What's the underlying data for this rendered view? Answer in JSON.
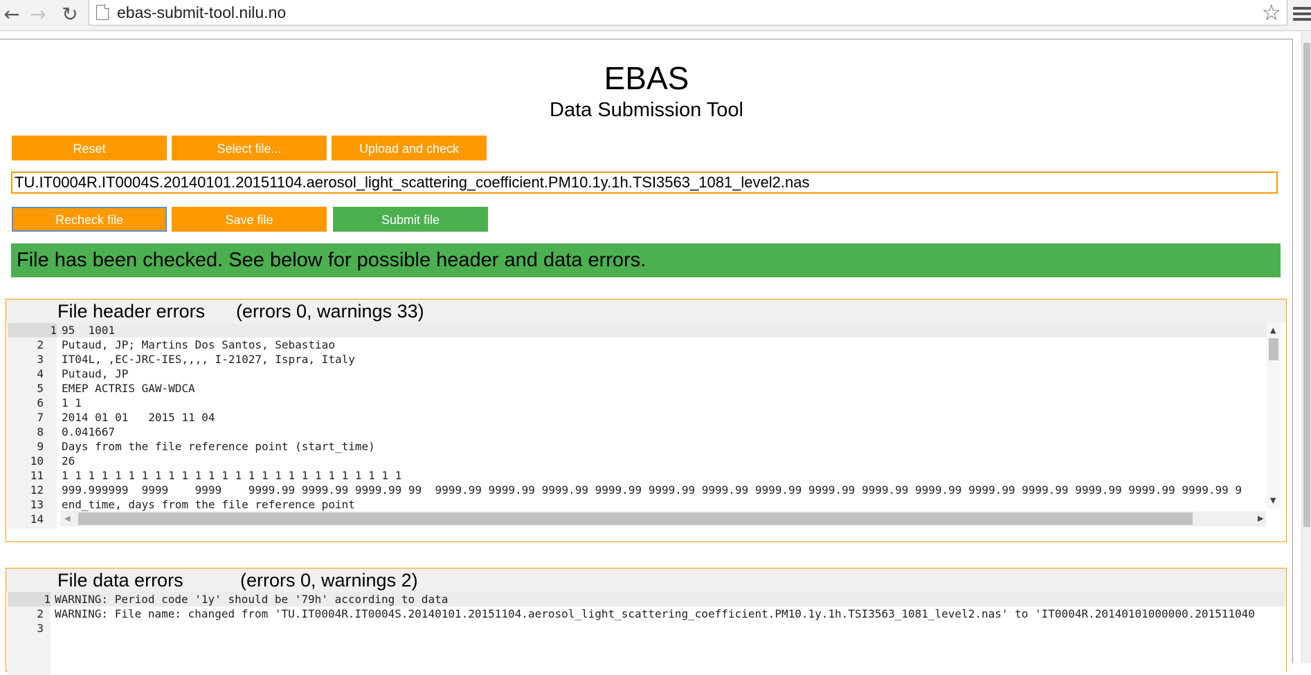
{
  "browser": {
    "url": "ebas-submit-tool.nilu.no",
    "back_icon": "back-arrow-icon",
    "forward_icon": "forward-arrow-icon",
    "reload_icon": "reload-icon",
    "bookmark_icon": "star-icon",
    "menu_icon": "hamburger-menu-icon"
  },
  "header": {
    "title": "EBAS",
    "subtitle": "Data Submission Tool"
  },
  "toolbar": {
    "reset_label": "Reset",
    "select_label": "Select file...",
    "upload_label": "Upload and check",
    "recheck_label": "Recheck file",
    "save_label": "Save file",
    "submit_label": "Submit file"
  },
  "filename": "TU.IT0004R.IT0004S.20140101.20151104.aerosol_light_scattering_coefficient.PM10.1y.1h.TSI3563_1081_level2.nas",
  "status": {
    "message": "File has been checked. See below for possible header and data errors.",
    "color": "#4caf50"
  },
  "colors": {
    "accent": "#ff9900",
    "success": "#4caf50"
  },
  "header_errors": {
    "title": "File header errors",
    "counts": "(errors 0, warnings 33)",
    "lines": [
      {
        "num": "1",
        "text": "95  1001"
      },
      {
        "num": "2",
        "text": "Putaud, JP; Martins Dos Santos, Sebastiao"
      },
      {
        "num": "3",
        "text": "IT04L, ,EC-JRC-IES,,,, I-21027, Ispra, Italy"
      },
      {
        "num": "4",
        "text": "Putaud, JP"
      },
      {
        "num": "5",
        "text": "EMEP ACTRIS GAW-WDCA"
      },
      {
        "num": "6",
        "text": "1 1"
      },
      {
        "num": "7",
        "text": "2014 01 01   2015 11 04"
      },
      {
        "num": "8",
        "text": "0.041667"
      },
      {
        "num": "9",
        "text": "Days from the file reference point (start_time)"
      },
      {
        "num": "10",
        "text": "26"
      },
      {
        "num": "11",
        "text": "1 1 1 1 1 1 1 1 1 1 1 1 1 1 1 1 1 1 1 1 1 1 1 1 1 1"
      },
      {
        "num": "12",
        "text": "999.999999  9999    9999    9999.99 9999.99 9999.99 99  9999.99 9999.99 9999.99 9999.99 9999.99 9999.99 9999.99 9999.99 9999.99 9999.99 9999.99 9999.99 9999.99 9999.99 9999.99 9"
      },
      {
        "num": "13",
        "text": "end_time, days from the file reference point"
      },
      {
        "num": "14",
        "text": ""
      }
    ]
  },
  "data_errors": {
    "title": "File data errors",
    "counts": "(errors 0, warnings 2)",
    "lines": [
      {
        "num": "1",
        "text": "WARNING: Period code '1y' should be '79h' according to data"
      },
      {
        "num": "2",
        "text": "WARNING: File name: changed from 'TU.IT0004R.IT0004S.20140101.20151104.aerosol_light_scattering_coefficient.PM10.1y.1h.TSI3563_1081_level2.nas' to 'IT0004R.20140101000000.201511040"
      },
      {
        "num": "3",
        "text": ""
      }
    ]
  }
}
